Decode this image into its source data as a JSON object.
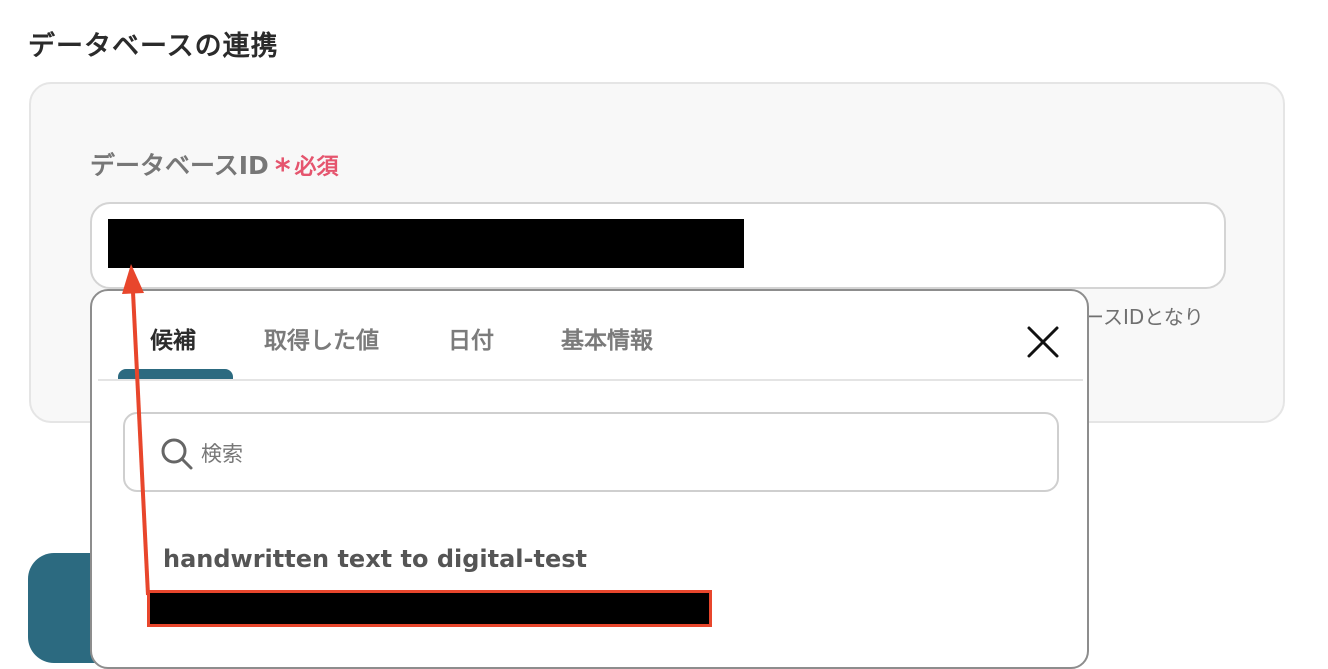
{
  "section": {
    "title": "データベースの連携"
  },
  "field": {
    "label": "データベースID",
    "required_mark": "*",
    "required_text": "必須",
    "helper_text_visible": "ースIDとなり"
  },
  "dropdown": {
    "tabs": [
      {
        "label": "候補",
        "active": true
      },
      {
        "label": "取得した値",
        "active": false
      },
      {
        "label": "日付",
        "active": false
      },
      {
        "label": "基本情報",
        "active": false
      }
    ],
    "search_placeholder": "検索",
    "options": [
      {
        "title": "handwritten text to digital-test"
      }
    ]
  },
  "colors": {
    "accent": "#2c6a80",
    "required": "#e5556e",
    "annotation": "#e8462c"
  }
}
